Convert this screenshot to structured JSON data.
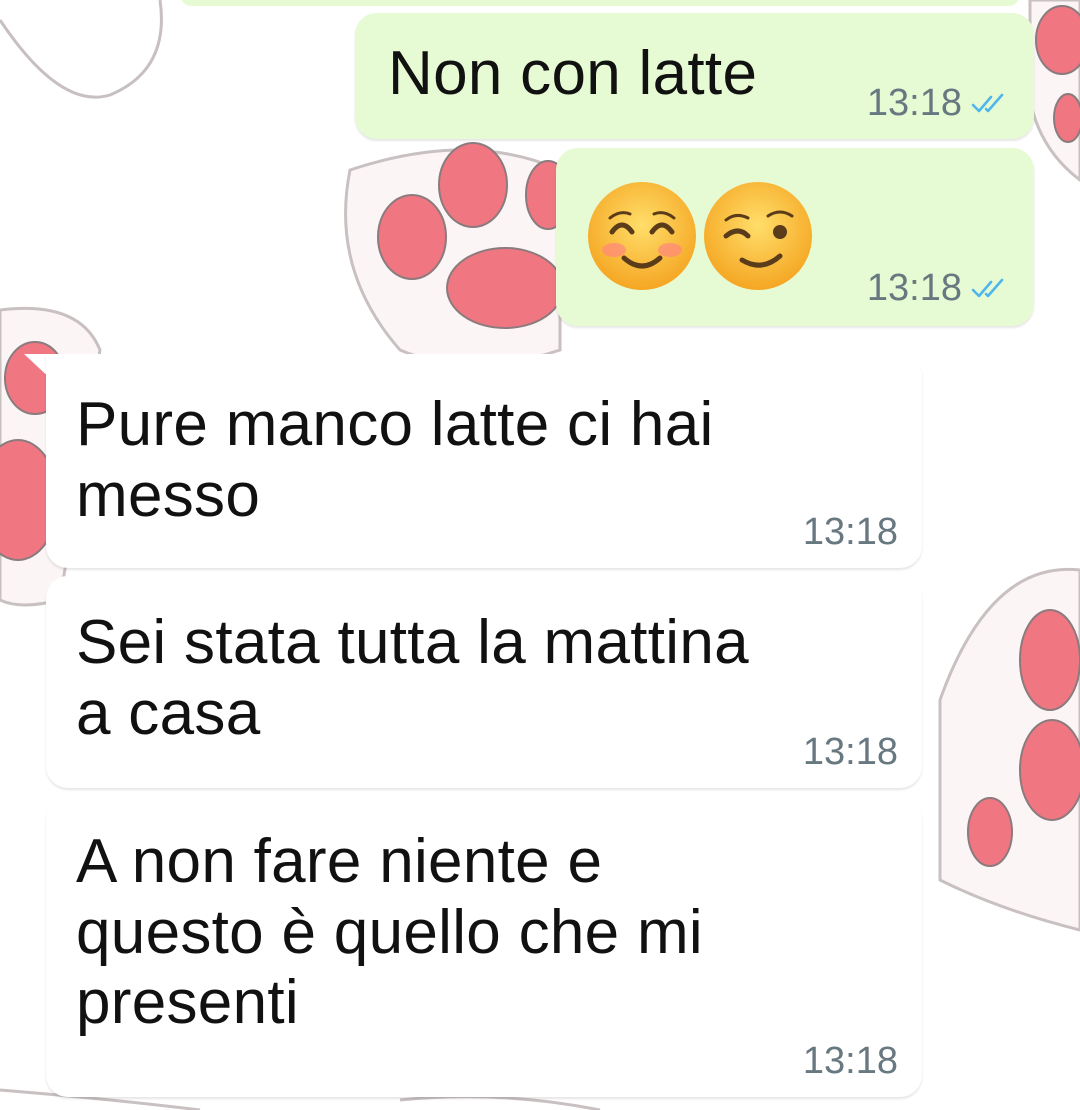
{
  "chat": {
    "messages": [
      {
        "direction": "outgoing",
        "text": "Non con latte",
        "time": "13:18",
        "status": "read",
        "status_icon": "double-check-icon"
      },
      {
        "direction": "outgoing",
        "emojis": [
          "smiling-face-with-smiling-eyes-icon",
          "relieved-face-icon"
        ],
        "time": "13:18",
        "status": "read",
        "status_icon": "double-check-icon"
      },
      {
        "direction": "incoming",
        "lines": [
          "Pure manco latte ci hai",
          "messo"
        ],
        "time": "13:18"
      },
      {
        "direction": "incoming",
        "lines": [
          "Sei stata tutta la mattina",
          "a casa"
        ],
        "time": "13:18"
      },
      {
        "direction": "incoming",
        "lines": [
          "A non fare niente e",
          "questo è quello che mi",
          "presenti"
        ],
        "time": "13:18"
      }
    ]
  },
  "colors": {
    "outgoing_bubble": "#e6fbd3",
    "incoming_bubble": "#ffffff",
    "read_ticks": "#4fb6ec",
    "timestamp": "#687880",
    "wallpaper_paw_pad": "#f0707e"
  }
}
